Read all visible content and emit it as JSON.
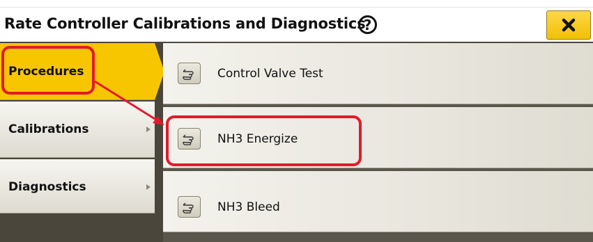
{
  "header": {
    "title": "Rate Controller Calibrations and Diagnostics",
    "help_icon": "question-mark-circle-icon",
    "close_icon": "close-x-icon"
  },
  "sidebar": {
    "items": [
      {
        "label": "Procedures",
        "active": true
      },
      {
        "label": "Calibrations",
        "active": false
      },
      {
        "label": "Diagnostics",
        "active": false
      }
    ]
  },
  "main": {
    "procedures": [
      {
        "label": "Control Valve Test",
        "icon": "pointing-hand-icon"
      },
      {
        "label": "NH3 Energize",
        "icon": "pointing-hand-icon"
      },
      {
        "label": "NH3 Bleed",
        "icon": "pointing-hand-icon"
      }
    ]
  },
  "colors": {
    "accent": "#f7c600",
    "highlight": "#e4192b",
    "frame": "#4a463c"
  }
}
